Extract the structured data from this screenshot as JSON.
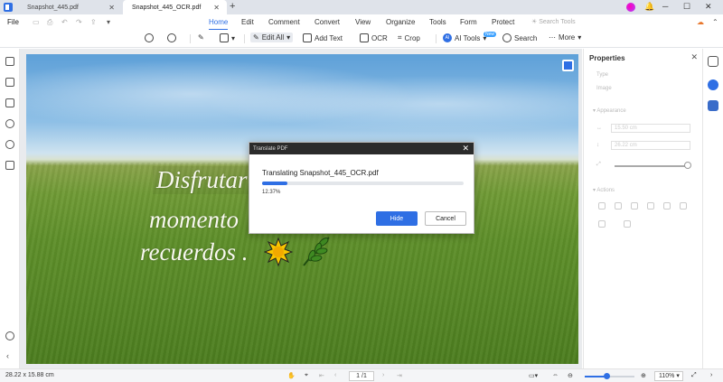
{
  "titlebar": {
    "tabs": [
      {
        "label": "Snapshot_445.pdf",
        "active": false
      },
      {
        "label": "Snapshot_445_OCR.pdf",
        "active": true
      }
    ],
    "new_tab": "+",
    "minimize": "─",
    "maximize": "☐",
    "close": "✕"
  },
  "menubar": {
    "file_label": "File",
    "items": [
      "Home",
      "Edit",
      "Comment",
      "Convert",
      "View",
      "Organize",
      "Tools",
      "Form",
      "Protect"
    ],
    "active": "Home",
    "search_placeholder": "Search Tools"
  },
  "toolbar": {
    "edit_all": "Edit All",
    "add_text": "Add Text",
    "ocr": "OCR",
    "crop": "Crop",
    "ai_tools": "AI Tools",
    "ai_badge": "AI",
    "new_badge": "New",
    "search": "Search",
    "more": "More"
  },
  "document": {
    "ocr_lines": [
      "Disfrutar",
      "momento",
      "recuerdos ."
    ]
  },
  "dialog": {
    "header": "Translate PDF",
    "title": "Translating Snapshot_445_OCR.pdf",
    "progress_percent": 12.37,
    "progress_text": "12.37%",
    "hide_label": "Hide",
    "cancel_label": "Cancel"
  },
  "properties": {
    "title": "Properties",
    "type_label": "Type",
    "type_value": "Image",
    "appearance_label": "Appearance",
    "width_value": "15.50",
    "width_unit": "cm",
    "height_value": "26.22",
    "height_unit": "cm",
    "actions_label": "Actions"
  },
  "statusbar": {
    "dimensions": "28.22 x 15.88 cm",
    "page_current": "1",
    "page_total": "/1",
    "zoom_value": "110%"
  },
  "colors": {
    "accent": "#2f6fe4"
  }
}
